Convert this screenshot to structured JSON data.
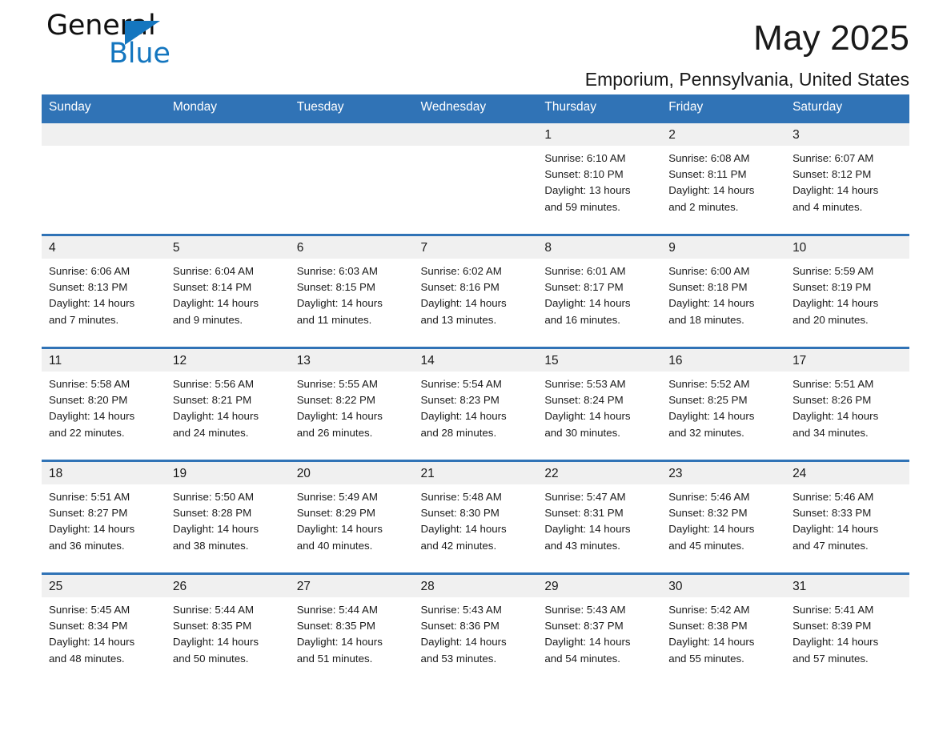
{
  "brand": {
    "name_part1": "General",
    "name_part2": "Blue",
    "logo_accent_color": "#1476bf"
  },
  "header": {
    "month_title": "May 2025",
    "location": "Emporium, Pennsylvania, United States",
    "header_bar_color": "#3073b6",
    "band_color": "#f0f0f0"
  },
  "weekdays": [
    "Sunday",
    "Monday",
    "Tuesday",
    "Wednesday",
    "Thursday",
    "Friday",
    "Saturday"
  ],
  "weeks": [
    {
      "days": [
        {
          "date": "",
          "sunrise": "",
          "sunset": "",
          "daylight_line1": "",
          "daylight_line2": ""
        },
        {
          "date": "",
          "sunrise": "",
          "sunset": "",
          "daylight_line1": "",
          "daylight_line2": ""
        },
        {
          "date": "",
          "sunrise": "",
          "sunset": "",
          "daylight_line1": "",
          "daylight_line2": ""
        },
        {
          "date": "",
          "sunrise": "",
          "sunset": "",
          "daylight_line1": "",
          "daylight_line2": ""
        },
        {
          "date": "1",
          "sunrise": "Sunrise: 6:10 AM",
          "sunset": "Sunset: 8:10 PM",
          "daylight_line1": "Daylight: 13 hours",
          "daylight_line2": "and 59 minutes."
        },
        {
          "date": "2",
          "sunrise": "Sunrise: 6:08 AM",
          "sunset": "Sunset: 8:11 PM",
          "daylight_line1": "Daylight: 14 hours",
          "daylight_line2": "and 2 minutes."
        },
        {
          "date": "3",
          "sunrise": "Sunrise: 6:07 AM",
          "sunset": "Sunset: 8:12 PM",
          "daylight_line1": "Daylight: 14 hours",
          "daylight_line2": "and 4 minutes."
        }
      ]
    },
    {
      "days": [
        {
          "date": "4",
          "sunrise": "Sunrise: 6:06 AM",
          "sunset": "Sunset: 8:13 PM",
          "daylight_line1": "Daylight: 14 hours",
          "daylight_line2": "and 7 minutes."
        },
        {
          "date": "5",
          "sunrise": "Sunrise: 6:04 AM",
          "sunset": "Sunset: 8:14 PM",
          "daylight_line1": "Daylight: 14 hours",
          "daylight_line2": "and 9 minutes."
        },
        {
          "date": "6",
          "sunrise": "Sunrise: 6:03 AM",
          "sunset": "Sunset: 8:15 PM",
          "daylight_line1": "Daylight: 14 hours",
          "daylight_line2": "and 11 minutes."
        },
        {
          "date": "7",
          "sunrise": "Sunrise: 6:02 AM",
          "sunset": "Sunset: 8:16 PM",
          "daylight_line1": "Daylight: 14 hours",
          "daylight_line2": "and 13 minutes."
        },
        {
          "date": "8",
          "sunrise": "Sunrise: 6:01 AM",
          "sunset": "Sunset: 8:17 PM",
          "daylight_line1": "Daylight: 14 hours",
          "daylight_line2": "and 16 minutes."
        },
        {
          "date": "9",
          "sunrise": "Sunrise: 6:00 AM",
          "sunset": "Sunset: 8:18 PM",
          "daylight_line1": "Daylight: 14 hours",
          "daylight_line2": "and 18 minutes."
        },
        {
          "date": "10",
          "sunrise": "Sunrise: 5:59 AM",
          "sunset": "Sunset: 8:19 PM",
          "daylight_line1": "Daylight: 14 hours",
          "daylight_line2": "and 20 minutes."
        }
      ]
    },
    {
      "days": [
        {
          "date": "11",
          "sunrise": "Sunrise: 5:58 AM",
          "sunset": "Sunset: 8:20 PM",
          "daylight_line1": "Daylight: 14 hours",
          "daylight_line2": "and 22 minutes."
        },
        {
          "date": "12",
          "sunrise": "Sunrise: 5:56 AM",
          "sunset": "Sunset: 8:21 PM",
          "daylight_line1": "Daylight: 14 hours",
          "daylight_line2": "and 24 minutes."
        },
        {
          "date": "13",
          "sunrise": "Sunrise: 5:55 AM",
          "sunset": "Sunset: 8:22 PM",
          "daylight_line1": "Daylight: 14 hours",
          "daylight_line2": "and 26 minutes."
        },
        {
          "date": "14",
          "sunrise": "Sunrise: 5:54 AM",
          "sunset": "Sunset: 8:23 PM",
          "daylight_line1": "Daylight: 14 hours",
          "daylight_line2": "and 28 minutes."
        },
        {
          "date": "15",
          "sunrise": "Sunrise: 5:53 AM",
          "sunset": "Sunset: 8:24 PM",
          "daylight_line1": "Daylight: 14 hours",
          "daylight_line2": "and 30 minutes."
        },
        {
          "date": "16",
          "sunrise": "Sunrise: 5:52 AM",
          "sunset": "Sunset: 8:25 PM",
          "daylight_line1": "Daylight: 14 hours",
          "daylight_line2": "and 32 minutes."
        },
        {
          "date": "17",
          "sunrise": "Sunrise: 5:51 AM",
          "sunset": "Sunset: 8:26 PM",
          "daylight_line1": "Daylight: 14 hours",
          "daylight_line2": "and 34 minutes."
        }
      ]
    },
    {
      "days": [
        {
          "date": "18",
          "sunrise": "Sunrise: 5:51 AM",
          "sunset": "Sunset: 8:27 PM",
          "daylight_line1": "Daylight: 14 hours",
          "daylight_line2": "and 36 minutes."
        },
        {
          "date": "19",
          "sunrise": "Sunrise: 5:50 AM",
          "sunset": "Sunset: 8:28 PM",
          "daylight_line1": "Daylight: 14 hours",
          "daylight_line2": "and 38 minutes."
        },
        {
          "date": "20",
          "sunrise": "Sunrise: 5:49 AM",
          "sunset": "Sunset: 8:29 PM",
          "daylight_line1": "Daylight: 14 hours",
          "daylight_line2": "and 40 minutes."
        },
        {
          "date": "21",
          "sunrise": "Sunrise: 5:48 AM",
          "sunset": "Sunset: 8:30 PM",
          "daylight_line1": "Daylight: 14 hours",
          "daylight_line2": "and 42 minutes."
        },
        {
          "date": "22",
          "sunrise": "Sunrise: 5:47 AM",
          "sunset": "Sunset: 8:31 PM",
          "daylight_line1": "Daylight: 14 hours",
          "daylight_line2": "and 43 minutes."
        },
        {
          "date": "23",
          "sunrise": "Sunrise: 5:46 AM",
          "sunset": "Sunset: 8:32 PM",
          "daylight_line1": "Daylight: 14 hours",
          "daylight_line2": "and 45 minutes."
        },
        {
          "date": "24",
          "sunrise": "Sunrise: 5:46 AM",
          "sunset": "Sunset: 8:33 PM",
          "daylight_line1": "Daylight: 14 hours",
          "daylight_line2": "and 47 minutes."
        }
      ]
    },
    {
      "days": [
        {
          "date": "25",
          "sunrise": "Sunrise: 5:45 AM",
          "sunset": "Sunset: 8:34 PM",
          "daylight_line1": "Daylight: 14 hours",
          "daylight_line2": "and 48 minutes."
        },
        {
          "date": "26",
          "sunrise": "Sunrise: 5:44 AM",
          "sunset": "Sunset: 8:35 PM",
          "daylight_line1": "Daylight: 14 hours",
          "daylight_line2": "and 50 minutes."
        },
        {
          "date": "27",
          "sunrise": "Sunrise: 5:44 AM",
          "sunset": "Sunset: 8:35 PM",
          "daylight_line1": "Daylight: 14 hours",
          "daylight_line2": "and 51 minutes."
        },
        {
          "date": "28",
          "sunrise": "Sunrise: 5:43 AM",
          "sunset": "Sunset: 8:36 PM",
          "daylight_line1": "Daylight: 14 hours",
          "daylight_line2": "and 53 minutes."
        },
        {
          "date": "29",
          "sunrise": "Sunrise: 5:43 AM",
          "sunset": "Sunset: 8:37 PM",
          "daylight_line1": "Daylight: 14 hours",
          "daylight_line2": "and 54 minutes."
        },
        {
          "date": "30",
          "sunrise": "Sunrise: 5:42 AM",
          "sunset": "Sunset: 8:38 PM",
          "daylight_line1": "Daylight: 14 hours",
          "daylight_line2": "and 55 minutes."
        },
        {
          "date": "31",
          "sunrise": "Sunrise: 5:41 AM",
          "sunset": "Sunset: 8:39 PM",
          "daylight_line1": "Daylight: 14 hours",
          "daylight_line2": "and 57 minutes."
        }
      ]
    }
  ]
}
